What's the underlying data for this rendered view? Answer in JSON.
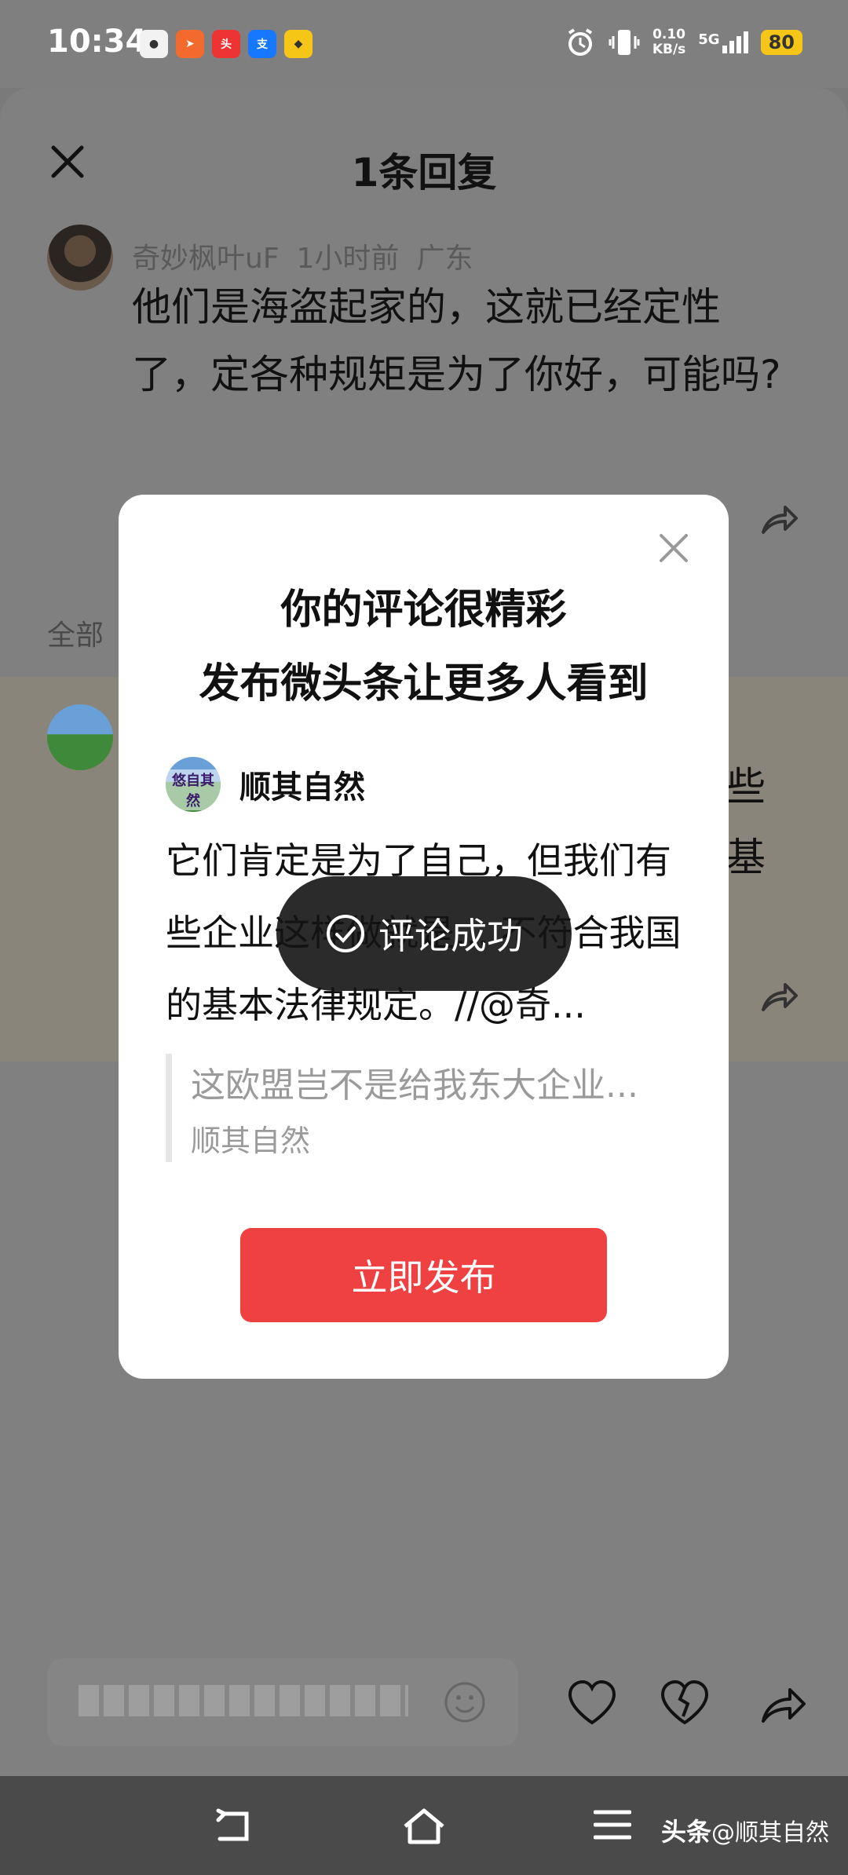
{
  "status_bar": {
    "time": "10:34",
    "net_speed": "0.10",
    "net_unit": "KB/s",
    "signal": "5G",
    "battery": "80",
    "app_icons": [
      "app-icon",
      "arrow-app-icon",
      "toutiao-app-icon",
      "alipay-app-icon",
      "app-icon"
    ]
  },
  "sheet": {
    "title": "1条回复",
    "comment": {
      "author": "奇妙枫叶uF",
      "time": "1小时前",
      "location": "广东",
      "text": "他们是海盗起家的，这就已经定性了，定各种规矩是为了你好，可能吗?"
    },
    "all_label": "全部",
    "reply_peek": {
      "line1": "些",
      "line2": "基"
    }
  },
  "dialog": {
    "title_line1": "你的评论很精彩",
    "title_line2": "发布微头条让更多人看到",
    "username": "顺其自然",
    "avatar_text": "悠自其然",
    "body": "它们肯定是为了自己，但我们有些企业这样做就是... 不符合我国的基本法律规定。//@奇...",
    "quote_text": "这欧盟岂不是给我东大企业...",
    "quote_author": "顺其自然",
    "publish_label": "立即发布"
  },
  "toast": {
    "text": "评论成功"
  },
  "bottom_bar": {
    "icons": [
      "smile-icon",
      "heart-icon",
      "broken-heart-icon",
      "share-icon"
    ]
  },
  "navbar": {
    "watermark_brand": "头条",
    "watermark_user": "@顺其自然"
  },
  "colors": {
    "accent": "#f04142",
    "overlay": "#808080",
    "toast_bg": "#141414"
  }
}
